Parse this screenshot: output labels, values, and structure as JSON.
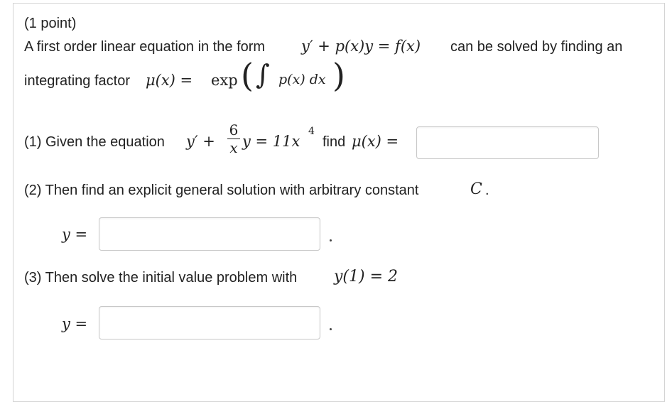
{
  "problem": {
    "points_label": "(1 point)",
    "intro_text": "A first order linear equation in the form",
    "intro_eq": "y′ + p(x)y = f(x)",
    "intro_tail": "can be solved by finding an",
    "factor_text": "integrating factor",
    "factor_lhs": "μ(x) = ",
    "factor_exp": "exp",
    "factor_integrand": "p(x) dx"
  },
  "part1": {
    "label": "(1) Given the equation",
    "eq_lhs": "y′ +",
    "frac_num": "6",
    "frac_den": "x",
    "eq_rhs": "y = 11x",
    "exponent": "4",
    "find_text": "find",
    "find_eq": "μ(x) =",
    "answer_value": ""
  },
  "part2": {
    "label": "(2) Then find an explicit general solution with arbitrary constant",
    "constant": "C",
    "period": ".",
    "y_label": "y =",
    "answer_value": ""
  },
  "part3": {
    "label": "(3) Then solve the initial value problem with",
    "condition": "y(1) = 2",
    "y_label": "y =",
    "answer_value": ""
  }
}
